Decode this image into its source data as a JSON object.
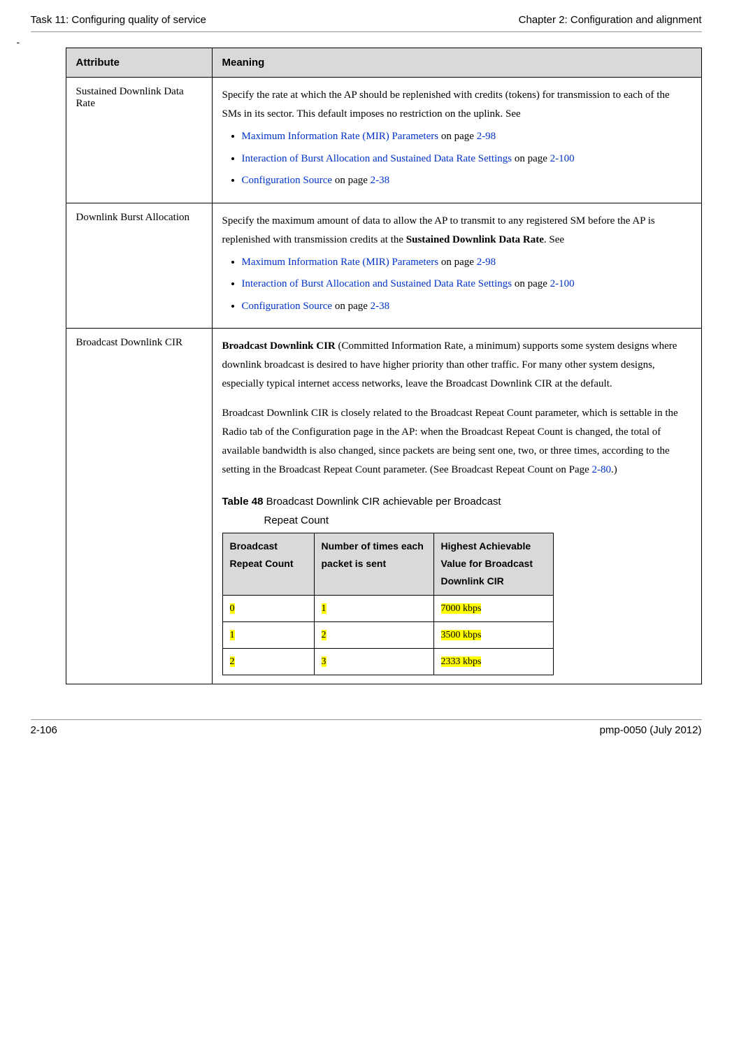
{
  "header": {
    "left": "Task 11: Configuring quality of service",
    "right": "Chapter 2:  Configuration and alignment"
  },
  "dash": "-",
  "table": {
    "headers": {
      "attr": "Attribute",
      "meaning": "Meaning"
    },
    "rows": [
      {
        "attr": "Sustained Downlink Data Rate",
        "intro": "Specify the rate at which the AP should be replenished with credits (tokens) for transmission to each of the SMs in its sector. This default imposes no restriction on the uplink. See",
        "links": [
          {
            "text": "Maximum Information Rate (MIR) Parameters",
            "suffix1": " on page ",
            "page": "2-98"
          },
          {
            "text": "Interaction of Burst Allocation and Sustained Data Rate Settings",
            "suffix1": " on page ",
            "page": "2-100"
          },
          {
            "text": "Configuration Source",
            "suffix1": " on page ",
            "page": "2-38"
          }
        ]
      },
      {
        "attr": "Downlink Burst Allocation",
        "intro_pre": "Specify the maximum amount of data to allow the AP to transmit to any registered SM before the AP is replenished with transmission credits at the ",
        "intro_bold": "Sustained Downlink Data Rate",
        "intro_post": ". See",
        "links": [
          {
            "text": "Maximum Information Rate (MIR) Parameters",
            "suffix1": " on page ",
            "page": "2-98"
          },
          {
            "text": "Interaction of Burst Allocation and Sustained Data Rate Settings",
            "suffix1": " on page ",
            "page": "2-100"
          },
          {
            "text": "Configuration Source",
            "suffix1": " on page ",
            "page": "2-38"
          }
        ]
      },
      {
        "attr": "Broadcast Downlink CIR",
        "para1_bold": "Broadcast Downlink CIR",
        "para1_rest": " (Committed Information Rate, a minimum) supports some system designs where downlink broadcast is desired to have higher priority than other traffic. For many other system designs, especially typical internet access networks, leave the Broadcast Downlink CIR at the default.",
        "para2_pre": "Broadcast Downlink CIR is closely related to the Broadcast Repeat Count parameter, which is settable in the Radio tab of the Configuration page in the AP: when the Broadcast Repeat Count is changed, the total of available bandwidth is also changed, since packets are being sent one, two, or three times, according to the setting in the Broadcast Repeat Count parameter. (See Broadcast Repeat Count on Page ",
        "para2_page": "2-80",
        "para2_post": ".)",
        "inner_caption_num": "Table 48",
        "inner_caption_text": " Broadcast Downlink CIR achievable per Broadcast",
        "inner_caption_text2": "Repeat Count",
        "inner_headers": {
          "c1": "Broadcast Repeat Count",
          "c2": "Number of times each packet is sent",
          "c3": "Highest Achievable Value for Broadcast Downlink CIR"
        },
        "chart_data": {
          "type": "table",
          "columns": [
            "Broadcast Repeat Count",
            "Number of times each packet is sent",
            "Highest Achievable Value for Broadcast Downlink CIR"
          ],
          "rows": [
            {
              "c1": "0",
              "c2": "1",
              "c3": "7000 kbps"
            },
            {
              "c1": "1",
              "c2": "2",
              "c3": "3500 kbps"
            },
            {
              "c1": "2",
              "c2": "3",
              "c3": "2333 kbps"
            }
          ]
        }
      }
    ]
  },
  "footer": {
    "left": "2-106",
    "right": "pmp-0050 (July 2012)"
  }
}
